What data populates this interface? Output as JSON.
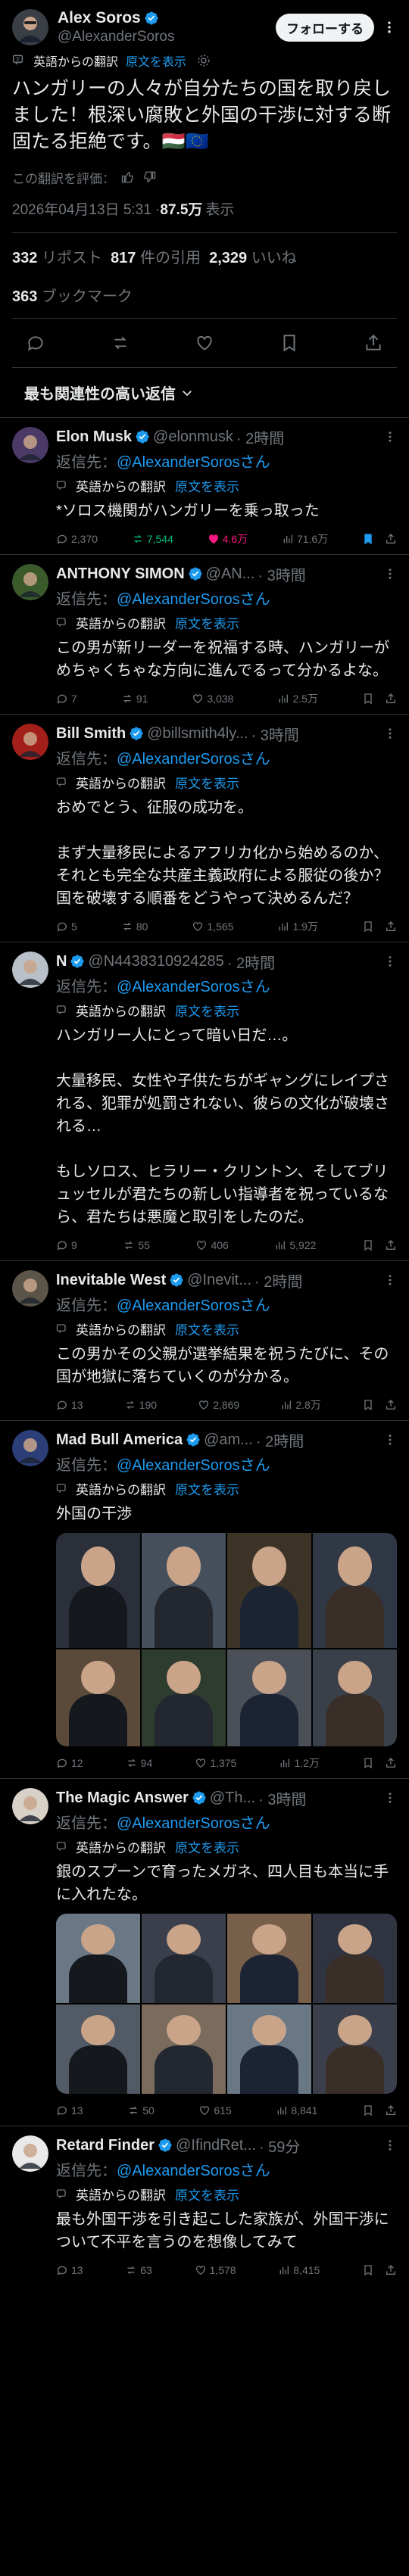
{
  "main": {
    "name": "Alex Soros",
    "handle": "@AlexanderSoros",
    "follow_label": "フォローする",
    "translated_label": "英語からの翻訳",
    "show_original": "原文を表示",
    "text": "ハンガリーの人々が自分たちの国を取り戻しました！根深い腐敗と外国の干渉に対する断固たる拒絶です。🇭🇺🇪🇺",
    "rate_label": "この翻訳を評価：",
    "timestamp": "2026年04月13日 5:31 · ",
    "views": "87.5万",
    "views_label": "表示",
    "reposts": "332",
    "reposts_label": "リポスト",
    "quotes": "817",
    "quotes_label": "件の引用",
    "likes": "2,329",
    "likes_label": "いいね",
    "bookmarks": "363",
    "bookmarks_label": "ブックマーク"
  },
  "sort_label": "最も関連性の高い返信",
  "reply_prefix": "返信先：",
  "reply_target": "@AlexanderSorosさん",
  "translated_label": "英語からの翻訳",
  "show_original": "原文を表示",
  "replies": [
    {
      "name": "Elon Musk",
      "handle": "@elonmusk",
      "time": "· 2時間",
      "text": "*ソロス機関がハンガリーを乗っ取った",
      "comments": "2,370",
      "reposts": "7,544",
      "likes": "4.6万",
      "views": "71.6万",
      "avatar_color": "#4b3a66"
    },
    {
      "name": "ANTHONY SIMON",
      "handle": "@AN...",
      "time": "· 3時間",
      "text": "この男が新リーダーを祝福する時、ハンガリーがめちゃくちゃな方向に進んでるって分かるよな。",
      "comments": "7",
      "reposts": "91",
      "likes": "3,038",
      "views": "2.5万",
      "avatar_color": "#3a5a2c"
    },
    {
      "name": "Bill Smith",
      "handle": "@billsmith4ly...",
      "time": "· 3時間",
      "text": "おめでとう、征服の成功を。\n\nまず大量移民によるアフリカ化から始めるのか、それとも完全な共産主義政府による服従の後か？ 国を破壊する順番をどうやって決めるんだ？",
      "comments": "5",
      "reposts": "80",
      "likes": "1,565",
      "views": "1.9万",
      "avatar_color": "#a3201a"
    },
    {
      "name": "N",
      "handle": "@N4438310924285",
      "time": "· 2時間",
      "text": "ハンガリー人にとって暗い日だ…。\n\n大量移民、女性や子供たちがギャングにレイプされる、犯罪が処罰されない、彼らの文化が破壊される…\n\nもしソロス、ヒラリー・クリントン、そしてブリュッセルが君たちの新しい指導者を祝っているなら、君たちは悪魔と取引をしたのだ。",
      "comments": "9",
      "reposts": "55",
      "likes": "406",
      "views": "5,922",
      "avatar_color": "#b9c0c7"
    },
    {
      "name": "Inevitable West",
      "handle": "@Inevit...",
      "time": "· 2時間",
      "text": "この男かその父親が選挙結果を祝うたびに、その国が地獄に落ちていくのが分かる。",
      "comments": "13",
      "reposts": "190",
      "likes": "2,869",
      "views": "2.8万",
      "avatar_color": "#5b5448"
    },
    {
      "name": "Mad Bull America",
      "handle": "@am...",
      "time": "· 2時間",
      "text": "外国の干渉",
      "comments": "12",
      "reposts": "94",
      "likes": "1,375",
      "views": "1.2万",
      "avatar_color": "#2c3e78"
    },
    {
      "name": "The Magic Answer",
      "handle": "@Th...",
      "time": "· 3時間",
      "text": "銀のスプーンで育ったメガネ、四人目も本当に手に入れたな。",
      "comments": "13",
      "reposts": "50",
      "likes": "615",
      "views": "8,841",
      "avatar_color": "#d8d1c8"
    },
    {
      "name": "Retard Finder",
      "handle": "@IfindRet...",
      "time": "· 59分",
      "text": "最も外国干渉を引き起こした家族が、外国干渉について不平を言うのを想像してみて",
      "comments": "13",
      "reposts": "63",
      "likes": "1,578",
      "views": "8,415",
      "avatar_color": "#e9e9e9"
    }
  ],
  "colors": {
    "background": "#000000",
    "text": "#e7e9ea",
    "muted": "#71767b",
    "link": "#1d9bf0",
    "repost_active": "#00ba7c",
    "like_active": "#f91880",
    "verified": "#1d9bf0"
  }
}
